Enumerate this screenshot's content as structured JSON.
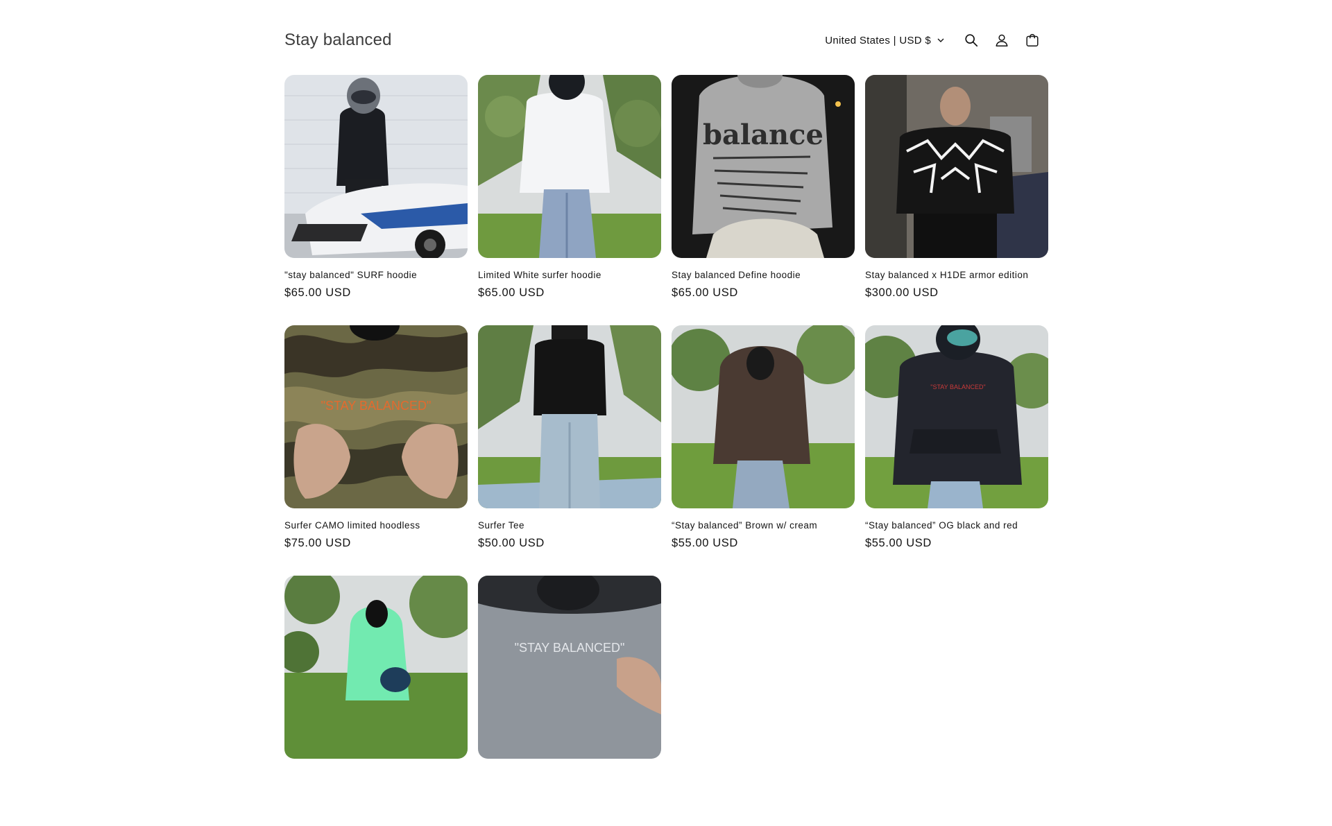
{
  "header": {
    "brand": "Stay balanced",
    "locale": "United States | USD $",
    "icons": [
      "search-icon",
      "account-icon",
      "cart-icon"
    ]
  },
  "products": [
    {
      "title": "\"stay balanced\" SURF hoodie",
      "price": "$65.00 USD",
      "image": "person-black-hoodie-helmet-motorcycle"
    },
    {
      "title": "Limited White surfer hoodie",
      "price": "$65.00 USD",
      "image": "person-white-hoodie-garden"
    },
    {
      "title": "Stay balanced Define hoodie",
      "price": "$65.00 USD",
      "image": "grey-hoodie-back-balance-print"
    },
    {
      "title": "Stay balanced x H1DE armor edition",
      "price": "$300.00 USD",
      "image": "reflective-black-hoodie-bedroom"
    },
    {
      "title": "Surfer CAMO limited hoodless",
      "price": "$75.00 USD",
      "image": "camo-shirt-orange-embroidery"
    },
    {
      "title": "Surfer Tee",
      "price": "$50.00 USD",
      "image": "person-black-tee-jeans"
    },
    {
      "title": "“Stay balanced” Brown w/ cream",
      "price": "$55.00 USD",
      "image": "person-brown-hoodie-garden"
    },
    {
      "title": "“Stay balanced” OG black and red",
      "price": "$55.00 USD",
      "image": "person-black-hoodie-red-print"
    },
    {
      "title": "",
      "price": "",
      "image": "person-mint-hoodie-garden"
    },
    {
      "title": "",
      "price": "",
      "image": "grey-shirt-stay-balanced-print"
    }
  ],
  "image_text": {
    "define": "balance",
    "camo": "\"STAY BALANCED\"",
    "grey": "\"STAY BALANCED\""
  }
}
